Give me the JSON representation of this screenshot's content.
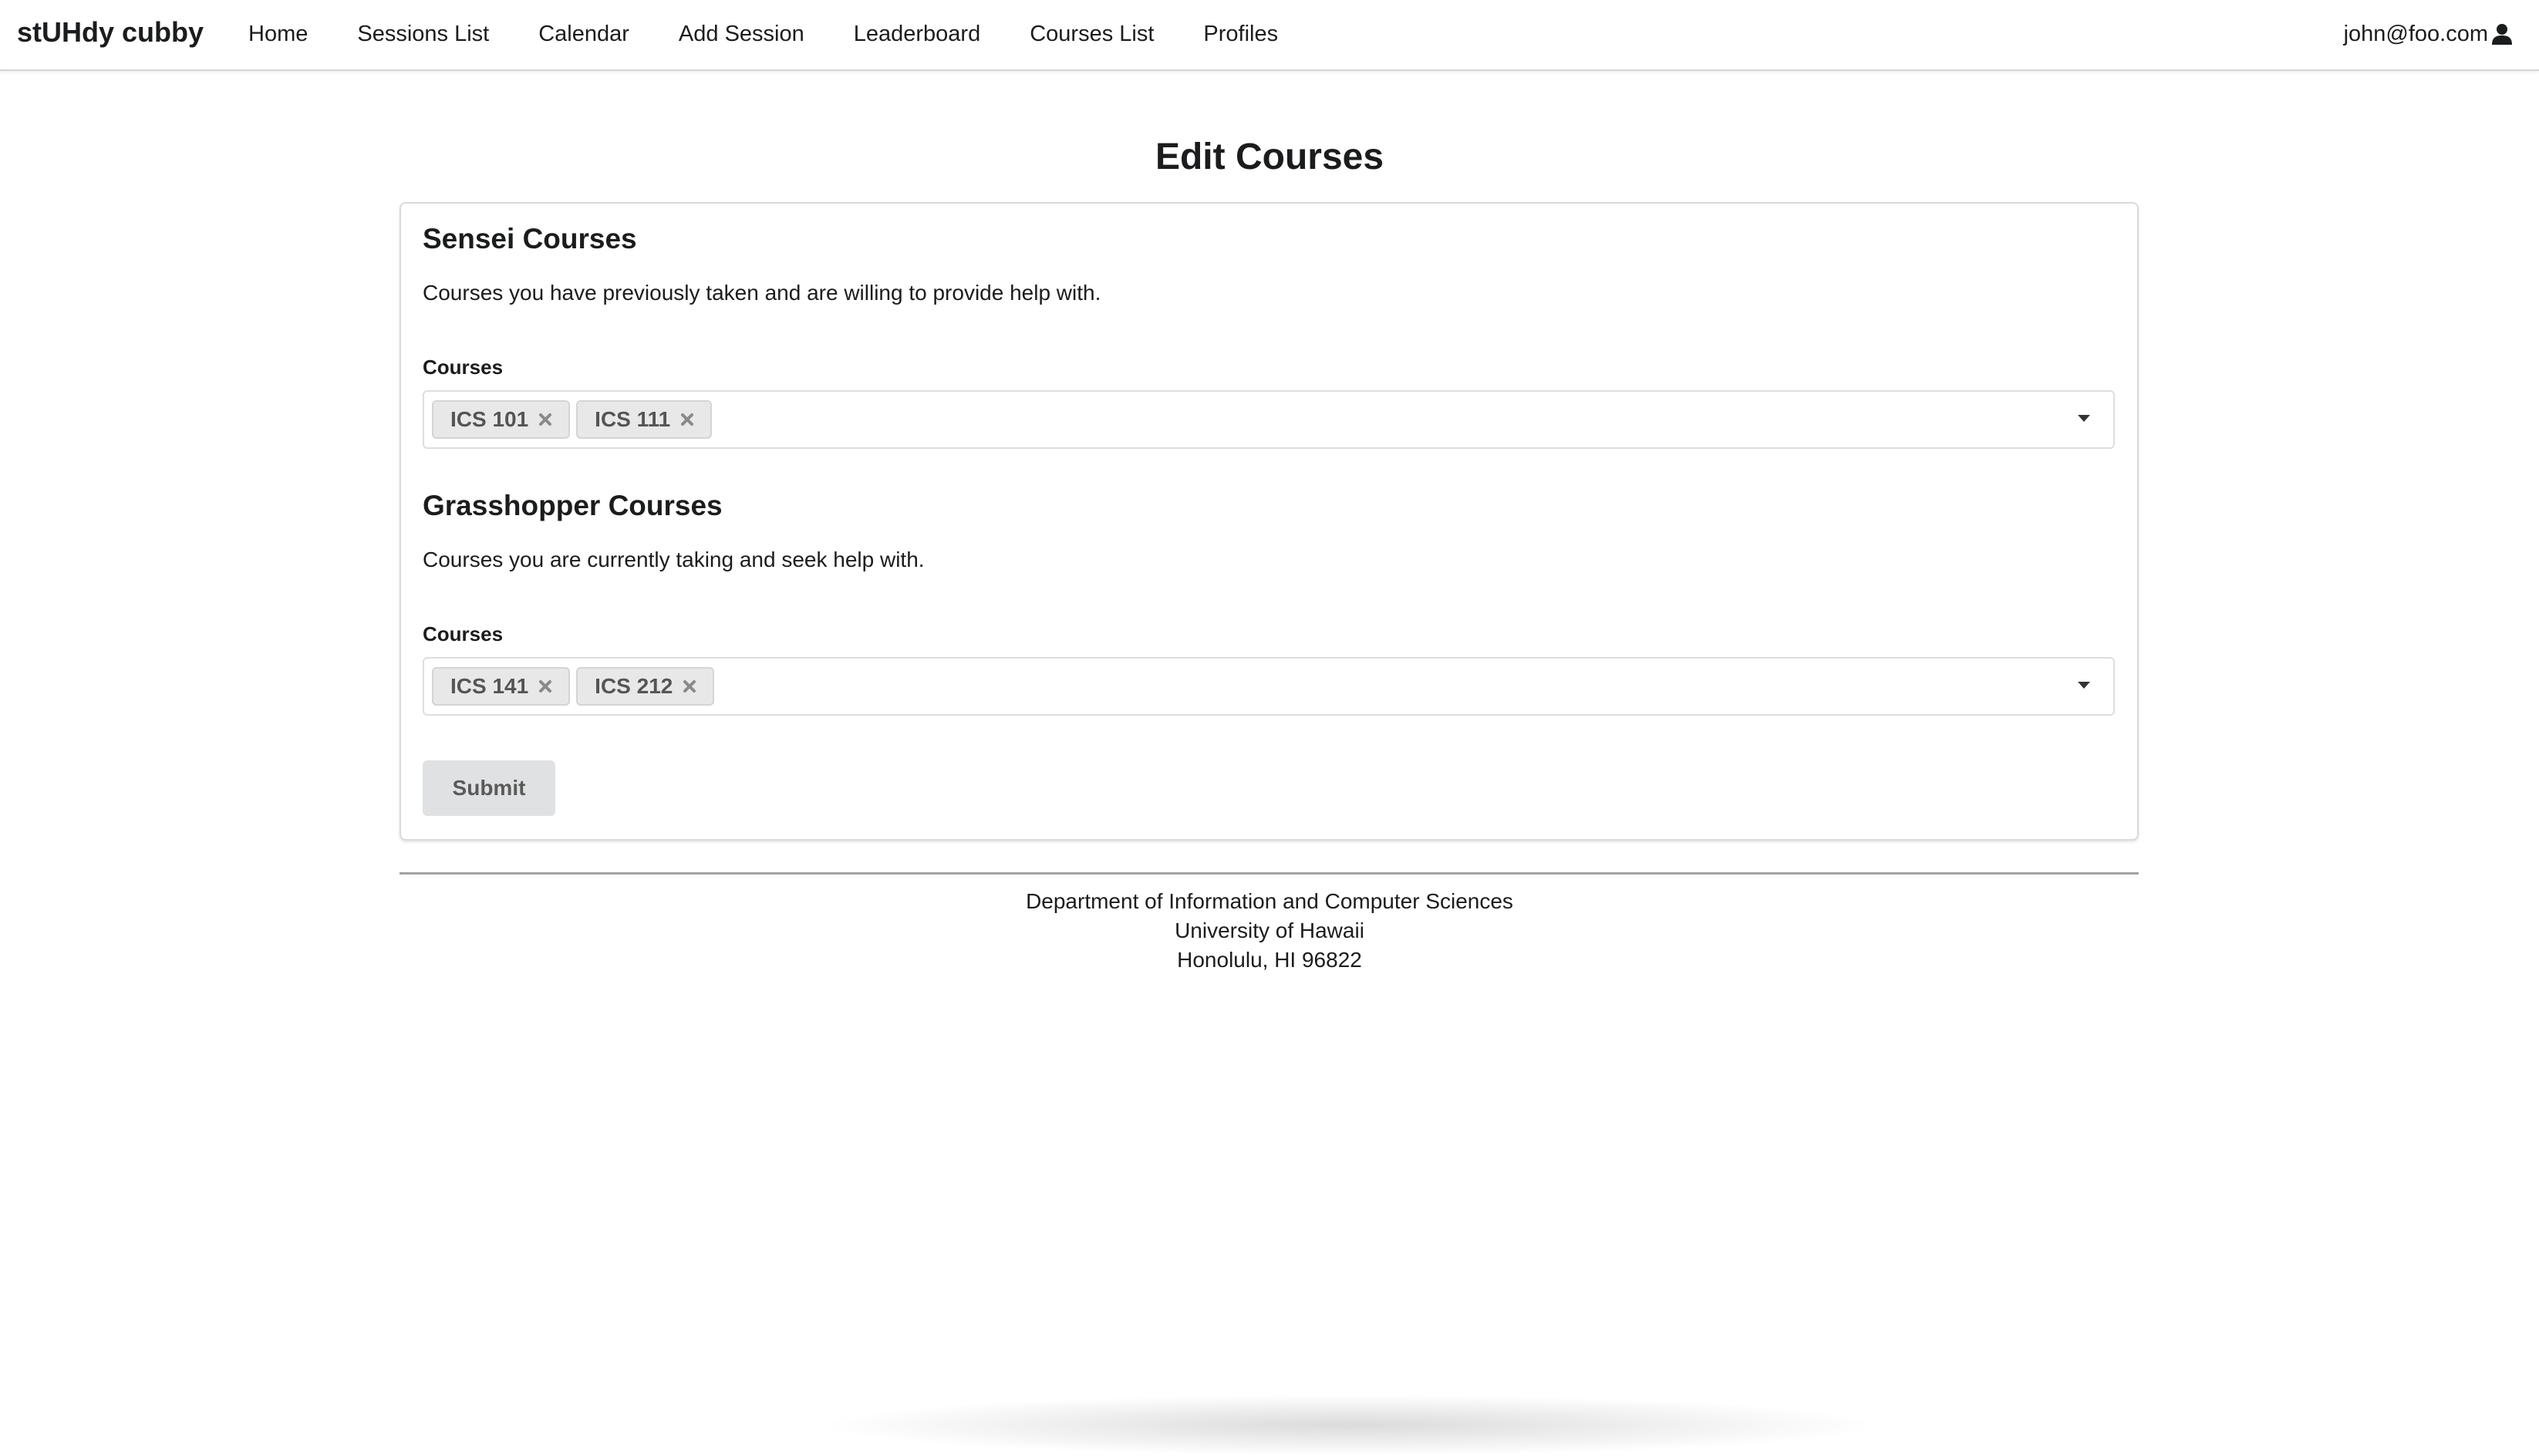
{
  "navbar": {
    "brand": "stUHdy cubby",
    "items": [
      {
        "label": "Home"
      },
      {
        "label": "Sessions List"
      },
      {
        "label": "Calendar"
      },
      {
        "label": "Add Session"
      },
      {
        "label": "Leaderboard"
      },
      {
        "label": "Courses List"
      },
      {
        "label": "Profiles"
      }
    ],
    "user_email": "john@foo.com",
    "user_icon": "user-icon"
  },
  "page": {
    "title": "Edit Courses"
  },
  "sensei": {
    "title": "Sensei Courses",
    "description": "Courses you have previously taken and are willing to provide help with.",
    "field_label": "Courses",
    "selected": [
      "ICS 101",
      "ICS 111"
    ]
  },
  "grasshopper": {
    "title": "Grasshopper Courses",
    "description": "Courses you are currently taking and seek help with.",
    "field_label": "Courses",
    "selected": [
      "ICS 141",
      "ICS 212"
    ]
  },
  "form": {
    "submit_label": "Submit"
  },
  "footer": {
    "line1": "Department of Information and Computer Sciences",
    "line2": "University of Hawaii",
    "line3": "Honolulu, HI 96822"
  },
  "colors": {
    "chip_bg": "#e8e8e8",
    "button_bg": "#e0e1e2",
    "text": "#1b1c1d"
  }
}
